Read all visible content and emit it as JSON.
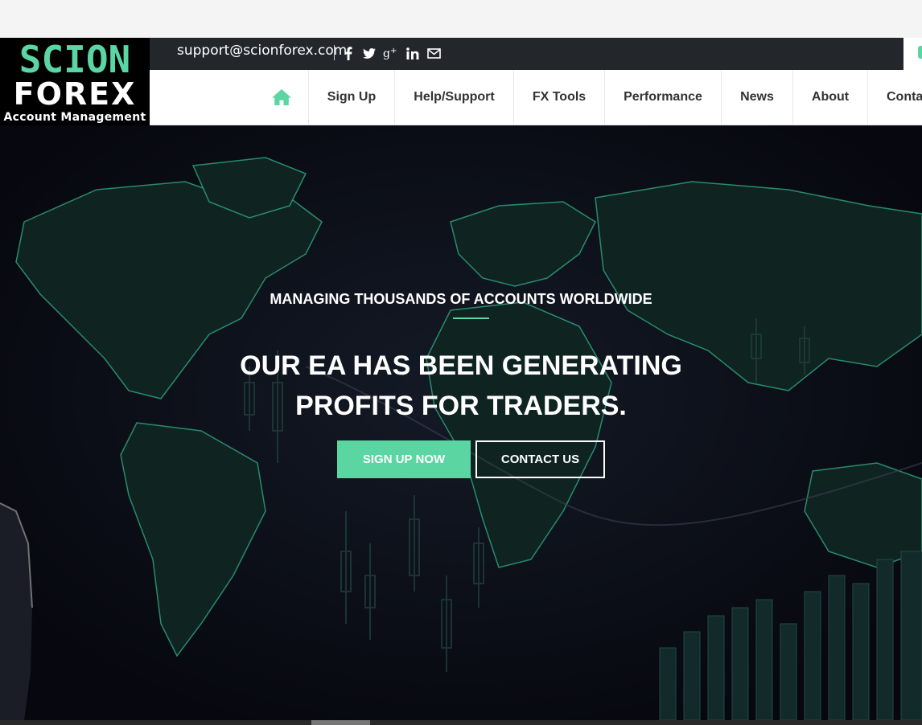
{
  "brand": {
    "line1": "SCION",
    "line2": "FOREX",
    "line3": "Account Management"
  },
  "topbar": {
    "email": "support@scionforex.com",
    "social": [
      "facebook-icon",
      "twitter-icon",
      "google-plus-icon",
      "linkedin-icon",
      "mail-icon"
    ]
  },
  "nav": {
    "home_icon": "home-icon",
    "items": [
      "Sign Up",
      "Help/Support",
      "FX Tools",
      "Performance",
      "News",
      "About",
      "Conta"
    ]
  },
  "hero": {
    "tagline": "MANAGING THOUSANDS OF ACCOUNTS WORLDWIDE",
    "headline_line1": "OUR EA HAS BEEN GENERATING",
    "headline_line2": "PROFITS FOR TRADERS.",
    "signup_label": "SIGN UP NOW",
    "contact_label": "CONTACT US"
  },
  "colors": {
    "accent": "#5bd6a2",
    "topbar": "#23262b",
    "hero_bg": "#0b0d18"
  }
}
